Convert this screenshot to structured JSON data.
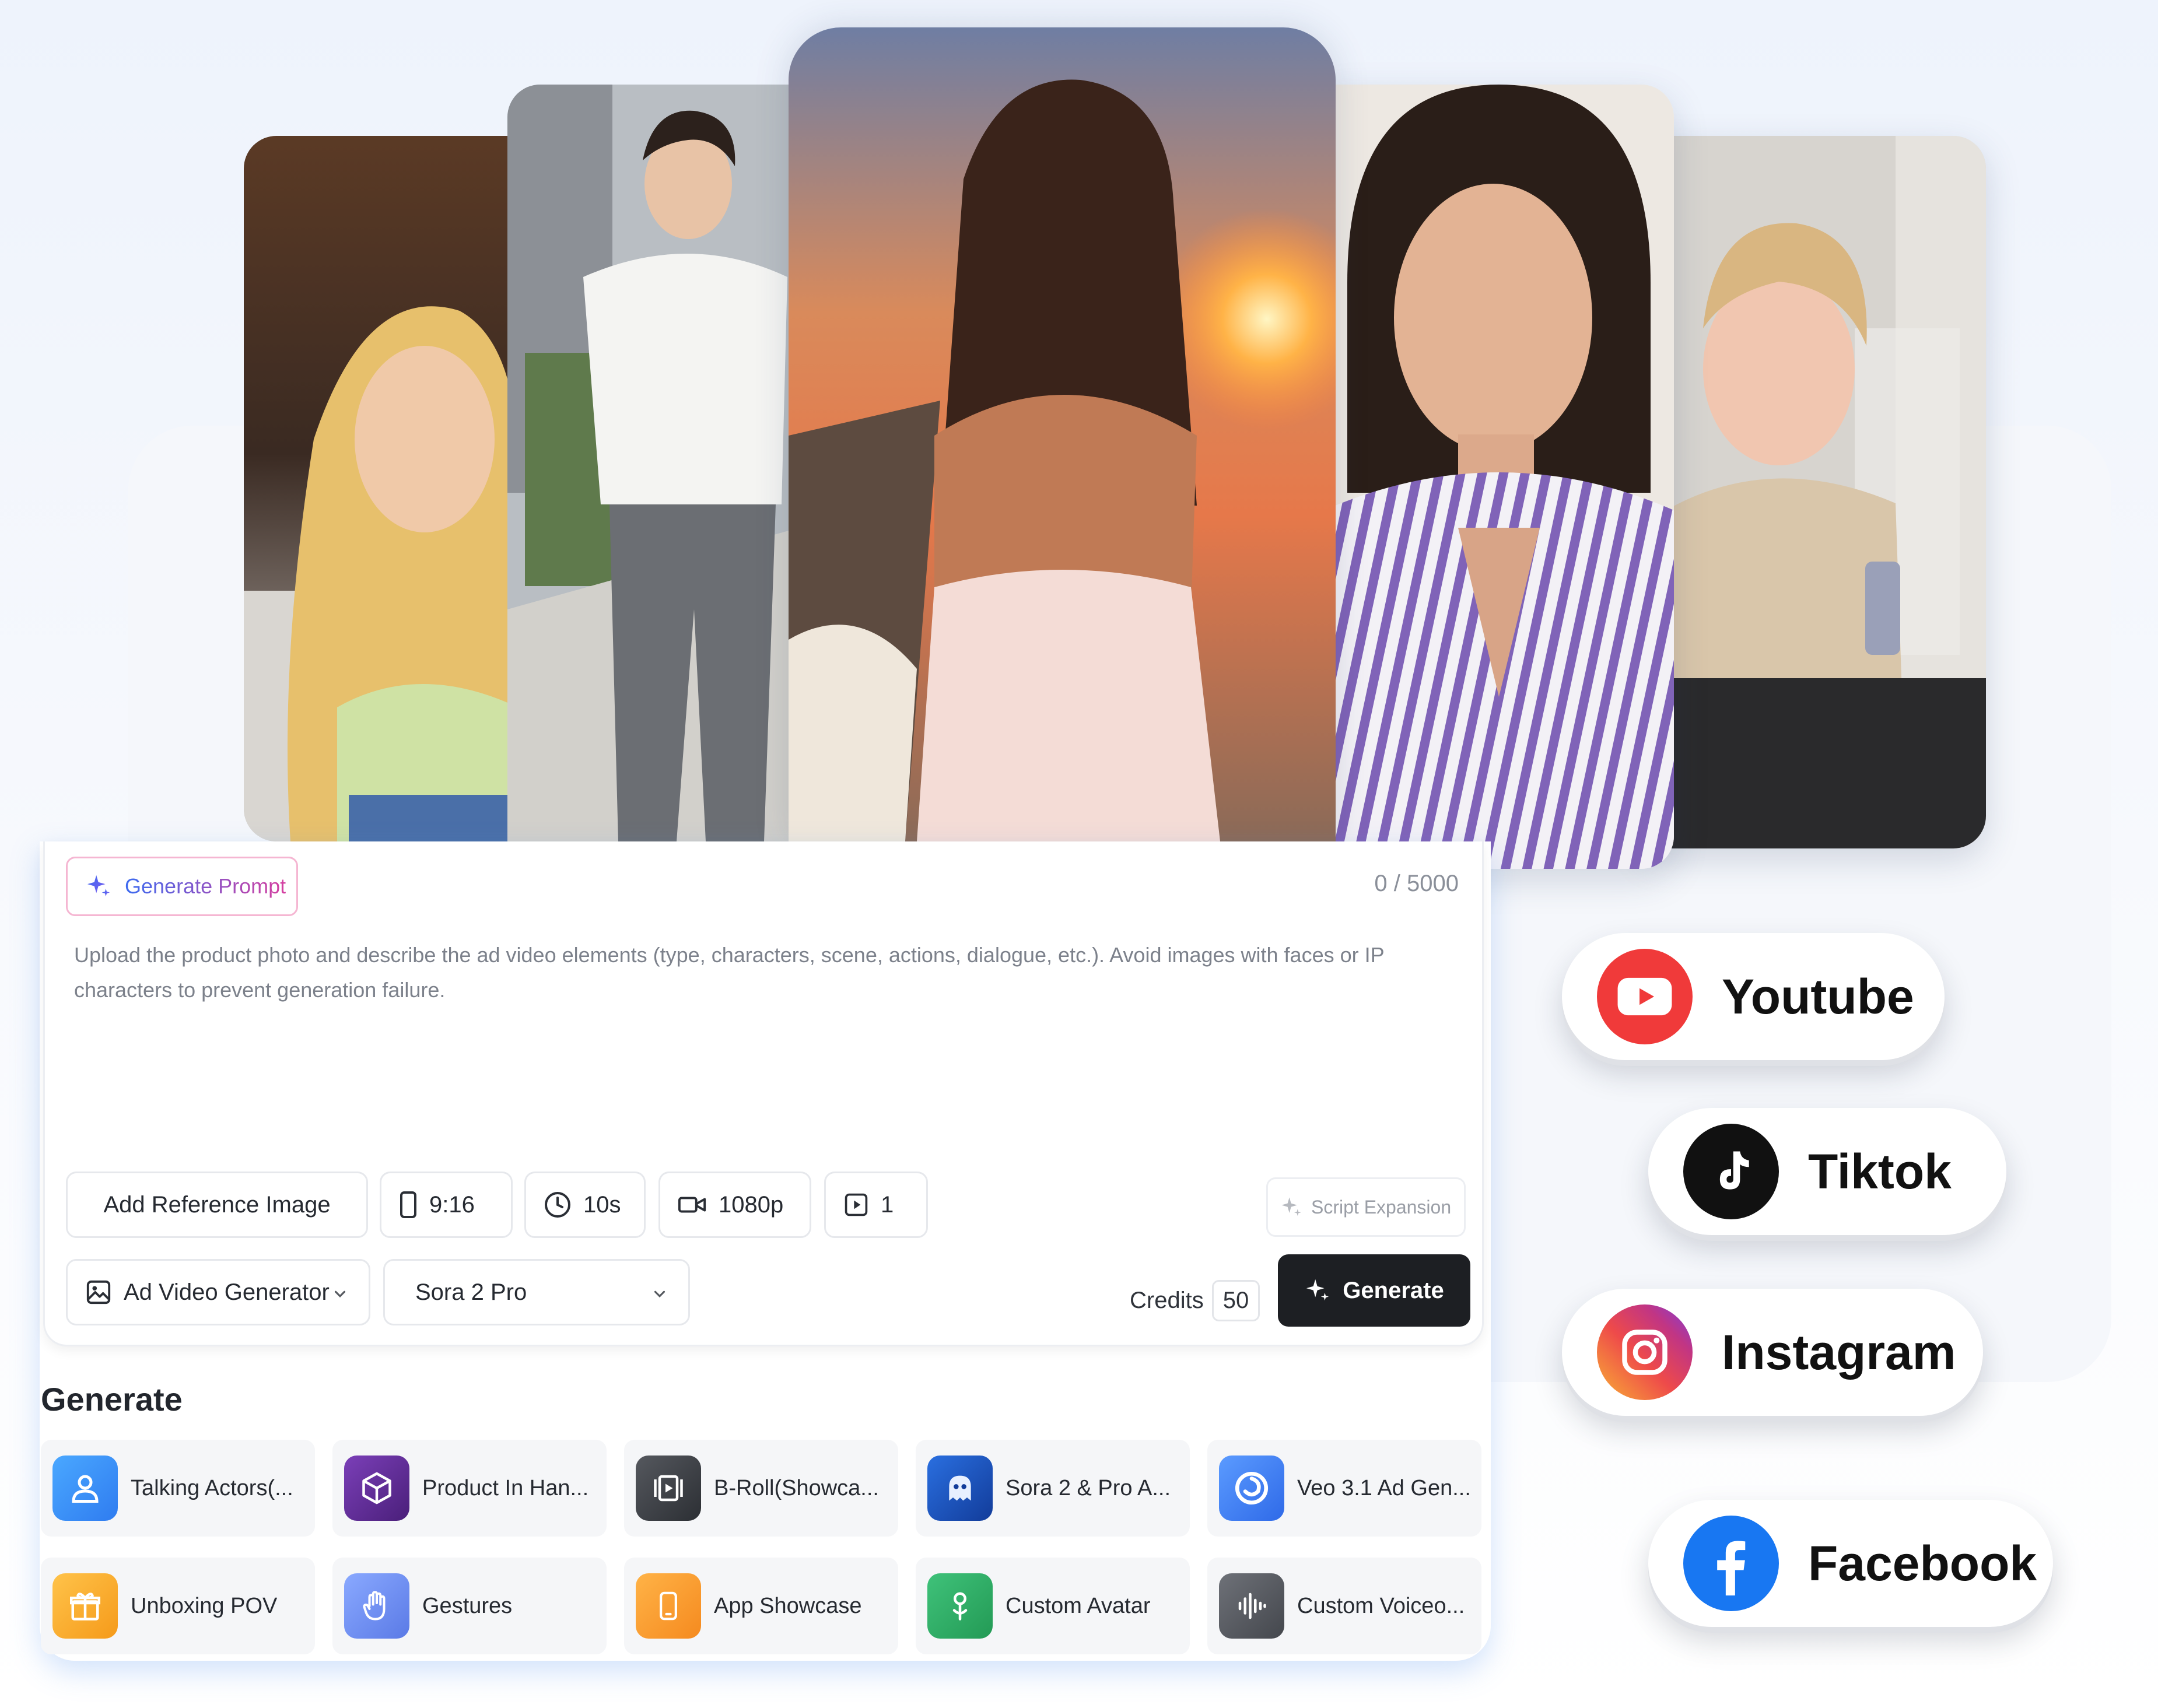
{
  "editor": {
    "generate_prompt_label": "Generate Prompt",
    "char_counter": "0 / 5000",
    "placeholder": "Upload the product photo and describe the ad video elements (type, characters, scene, actions, dialogue, etc.). Avoid images with faces or IP characters to prevent generation failure."
  },
  "options": {
    "add_reference_label": "Add Reference Image",
    "aspect_ratio": "9:16",
    "duration": "10s",
    "resolution": "1080p",
    "count": "1",
    "script_expansion_label": "Script Expansion"
  },
  "controls": {
    "generator_type": "Ad Video Generator",
    "model": "Sora 2 Pro",
    "credits_label": "Credits",
    "credits_value": "50",
    "generate_label": "Generate"
  },
  "generate_section": {
    "title": "Generate",
    "tools": [
      {
        "label": "Talking Actors(...",
        "icon": "person-icon",
        "color": "#3b8ef5"
      },
      {
        "label": "Product In Han...",
        "icon": "cube-icon",
        "color": "#6a2fa0"
      },
      {
        "label": "B-Roll(Showca...",
        "icon": "film-icon",
        "color": "#3c3f45"
      },
      {
        "label": "Sora 2 & Pro A...",
        "icon": "sora-ghost-icon",
        "color": "#1e5fd0"
      },
      {
        "label": "Veo 3.1 Ad Gen...",
        "icon": "veo-swirl-icon",
        "color": "#3f7df2"
      },
      {
        "label": "Unboxing POV",
        "icon": "gift-icon",
        "color": "#f5a623"
      },
      {
        "label": "Gestures",
        "icon": "hand-icon",
        "color": "#6c8ff0"
      },
      {
        "label": "App Showcase",
        "icon": "phone-icon",
        "color": "#f79a2a"
      },
      {
        "label": "Custom Avatar",
        "icon": "avatar-icon",
        "color": "#2fae67"
      },
      {
        "label": "Custom Voiceo...",
        "icon": "waveform-icon",
        "color": "#5c5f66"
      }
    ]
  },
  "social": [
    {
      "label": "Youtube",
      "icon": "youtube-icon",
      "color": "#f03a3a"
    },
    {
      "label": "Tiktok",
      "icon": "tiktok-icon",
      "color": "#111111"
    },
    {
      "label": "Instagram",
      "icon": "instagram-icon",
      "color": "#e1306c"
    },
    {
      "label": "Facebook",
      "icon": "facebook-icon",
      "color": "#1877f2"
    }
  ]
}
